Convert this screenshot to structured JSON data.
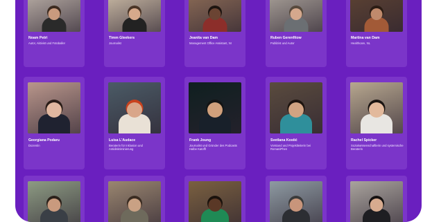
{
  "rows": [
    {
      "people": [
        {
          "name": "Noam Petri",
          "role": "Autor, Aktivist und Fotoballer",
          "bg": "#b7aca4",
          "skin": "#c99a7e",
          "shirt": "#2a2a2a",
          "hair": "#3b2a20"
        },
        {
          "name": "Timm Gleekers",
          "role": "Journalist",
          "bg": "#c9b9a4",
          "skin": "#d6a98b",
          "shirt": "#222222",
          "hair": "#4a3527"
        },
        {
          "name": "Jeanita van Dam",
          "role": "Management Office Assistant, NI",
          "bg": "#8a6a55",
          "skin": "#6b4433",
          "shirt": "#8c2e2a",
          "hair": "#1d1410"
        },
        {
          "name": "Ruben Gerenfitow",
          "role": "Publizist und Autor",
          "bg": "#a79f97",
          "skin": "#d4a88d",
          "shirt": "#6b6f73",
          "hair": "#57493d"
        },
        {
          "name": "Martina van Dam",
          "role": "Healthcare, NL",
          "bg": "#5c4232",
          "skin": "#c08a6c",
          "shirt": "#a25a37",
          "hair": "#2b1c14"
        }
      ]
    },
    {
      "people": [
        {
          "name": "Georgiana Podaru",
          "role": "Dozentin",
          "bg": "#b9968b",
          "skin": "#e0b7a0",
          "shirt": "#1f2230",
          "hair": "#2a1d18"
        },
        {
          "name": "Luisa L'Audace",
          "role": "Beraterin für Inklusion und Antidiskriminierung",
          "bg": "#4b5b66",
          "skin": "#d9a68a",
          "shirt": "#e9e1d6",
          "hair": "#c8421e"
        },
        {
          "name": "Frank Joung",
          "role": "Journalist und Gründer des Podcasts Halbe Katoffl",
          "bg": "#0f1f20",
          "skin": "#d0a07c",
          "shirt": "#18202a",
          "hair": "#141414"
        },
        {
          "name": "Svetlana Kostić",
          "role": "Vorstand und Projektleiterin bei RomaniPhen",
          "bg": "#5a4b3e",
          "skin": "#d1a382",
          "shirt": "#2f8f9b",
          "hair": "#1e140f"
        },
        {
          "name": "Rachel Spicker",
          "role": "Sozialwissenschaftlerin und systemische Beraterin",
          "bg": "#b7a78f",
          "skin": "#e2b99c",
          "shirt": "#e8e6e2",
          "hair": "#1a1412"
        }
      ]
    },
    {
      "people": [
        {
          "name": "",
          "role": "",
          "bg": "#8d9b83",
          "skin": "#c99a7e",
          "shirt": "#3a3f46",
          "hair": "#2b211b"
        },
        {
          "name": "",
          "role": "",
          "bg": "#9a8670",
          "skin": "#c9a184",
          "shirt": "#6e6a5c",
          "hair": "#3a2c22"
        },
        {
          "name": "",
          "role": "",
          "bg": "#7a6040",
          "skin": "#5a3826",
          "shirt": "#1f8a55",
          "hair": "#1a120d"
        },
        {
          "name": "",
          "role": "",
          "bg": "#8e9aa2",
          "skin": "#c8957b",
          "shirt": "#2c2e33",
          "hair": "#3b3b3b"
        },
        {
          "name": "",
          "role": "",
          "bg": "#a9a39d",
          "skin": "#d7ab8f",
          "shirt": "#1e1e22",
          "hair": "#151111"
        }
      ]
    }
  ]
}
